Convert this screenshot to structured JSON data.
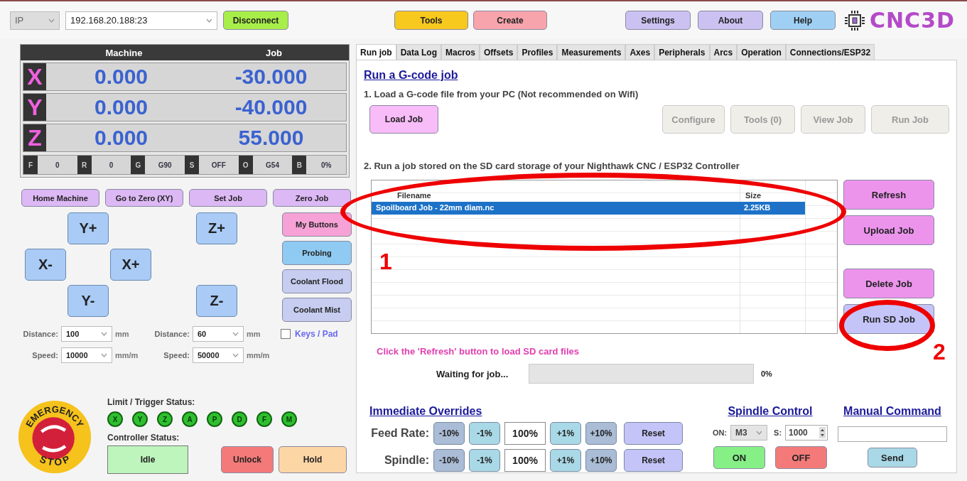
{
  "toolbar": {
    "connection_type": "IP",
    "address": "192.168.20.188:23",
    "left_buttons": [
      {
        "label": "Disconnect",
        "color": "#a8ee4a"
      }
    ],
    "center_buttons": [
      {
        "label": "Tools",
        "color": "#f7c81e"
      },
      {
        "label": "Create",
        "color": "#f8a4ac"
      }
    ],
    "right_buttons": [
      {
        "label": "Settings",
        "color": "#cbc2f2"
      },
      {
        "label": "About",
        "color": "#cbc2f2"
      },
      {
        "label": "Help",
        "color": "#9fd0f4"
      }
    ],
    "logo": "CNC3D"
  },
  "dro": {
    "columns": [
      "Machine",
      "Job"
    ],
    "axes": [
      {
        "axis": "X",
        "machine": "0.000",
        "job": "-30.000"
      },
      {
        "axis": "Y",
        "machine": "0.000",
        "job": "-40.000"
      },
      {
        "axis": "Z",
        "machine": "0.000",
        "job": "55.000"
      }
    ],
    "status": [
      {
        "key": "F",
        "value": "0"
      },
      {
        "key": "R",
        "value": "0"
      },
      {
        "key": "G",
        "value": "G90"
      },
      {
        "key": "S",
        "value": "OFF"
      },
      {
        "key": "O",
        "value": "G54"
      },
      {
        "key": "B",
        "value": "0%"
      }
    ]
  },
  "quick_buttons": [
    {
      "label": "Home Machine",
      "color": "#dcb8f4"
    },
    {
      "label": "Go to Zero (XY)",
      "color": "#dcb8f4"
    },
    {
      "label": "Set Job",
      "color": "#dcb8f4"
    },
    {
      "label": "Zero Job",
      "color": "#dcb8f4"
    }
  ],
  "jog_buttons": [
    {
      "label": "Y+"
    },
    {
      "label": "Z+"
    },
    {
      "label": "X-"
    },
    {
      "label": "X+"
    },
    {
      "label": "Y-"
    },
    {
      "label": "Z-"
    }
  ],
  "side_buttons": [
    {
      "label": "My Buttons",
      "color": "#f6a2d6"
    },
    {
      "label": "Probing",
      "color": "#8ecaf2"
    },
    {
      "label": "Coolant Flood",
      "color": "#c6cdf0"
    },
    {
      "label": "Coolant Mist",
      "color": "#c6cdf0"
    }
  ],
  "jog_settings": [
    {
      "label": "Distance:",
      "value": "100",
      "unit": "mm"
    },
    {
      "label": "Distance:",
      "value": "60",
      "unit": "mm"
    },
    {
      "label": "Speed:",
      "value": "10000",
      "unit": "mm/m"
    },
    {
      "label": "Speed:",
      "value": "50000",
      "unit": "mm/m"
    }
  ],
  "keys_pad": {
    "label": "Keys / Pad",
    "checked": false
  },
  "emergency_stop": {
    "top": "EMERGENCY",
    "bottom": "STOP"
  },
  "limits": {
    "label": "Limit / Trigger Status:",
    "pins": [
      "X",
      "Y",
      "Z",
      "A",
      "P",
      "D",
      "F",
      "M"
    ]
  },
  "controller": {
    "label": "Controller Status:",
    "status": "Idle",
    "buttons": [
      {
        "label": "Unlock",
        "color": "#f47a7a"
      },
      {
        "label": "Hold",
        "color": "#fdd6a6"
      }
    ]
  },
  "tabs": [
    {
      "label": "Run job",
      "selected": true
    },
    {
      "label": "Data Log",
      "selected": false
    },
    {
      "label": "Macros",
      "selected": false
    },
    {
      "label": "Offsets",
      "selected": false
    },
    {
      "label": "Profiles",
      "selected": false
    },
    {
      "label": "Measurements",
      "selected": false
    },
    {
      "label": "Axes",
      "selected": false
    },
    {
      "label": "Peripherals",
      "selected": false
    },
    {
      "label": "Arcs",
      "selected": false
    },
    {
      "label": "Operation",
      "selected": false
    },
    {
      "label": "Connections/ESP32",
      "selected": false
    }
  ],
  "run_job": {
    "title": "Run a G-code job",
    "step1": "1. Load a G-code file from your PC (Not recommended on Wifi)",
    "load_button": {
      "label": "Load Job",
      "color": "#f8bcf8",
      "disabled": false
    },
    "job_buttons": [
      {
        "label": "Configure",
        "color": "#efeee8",
        "disabled": true
      },
      {
        "label": "Tools (0)",
        "color": "#efeee8",
        "disabled": true
      },
      {
        "label": "View Job",
        "color": "#efeee8",
        "disabled": true
      },
      {
        "label": "Run Job",
        "color": "#efeee8",
        "disabled": true
      }
    ],
    "step2": "2. Run a job stored on the SD card storage of your Nighthawk CNC / ESP32 Controller",
    "table": {
      "columns": [
        "Filename",
        "Size"
      ],
      "rows": [
        {
          "filename": "Spoilboard Job - 22mm diam.nc",
          "size": "2.25KB",
          "selected": true
        }
      ]
    },
    "sd_buttons": [
      {
        "label": "Refresh",
        "color": "#ec94ec"
      },
      {
        "label": "Upload Job",
        "color": "#ec94ec"
      },
      {
        "label": "Delete Job",
        "color": "#ec94ec"
      },
      {
        "label": "Run SD Job",
        "color": "#c4c4f8"
      }
    ],
    "hint": "Click the 'Refresh' button to load SD card files",
    "progress": {
      "label": "Waiting for job...",
      "reading": "0%"
    }
  },
  "overrides": {
    "title": "Immediate Overrides",
    "rows": [
      {
        "label": "Feed Rate:",
        "value": "100%",
        "buttons": [
          {
            "label": "-10%",
            "color": "#aabcd6"
          },
          {
            "label": "-1%",
            "color": "#a9d8e6"
          },
          {
            "label": "+1%",
            "color": "#a9d8e6"
          },
          {
            "label": "+10%",
            "color": "#aabcd6"
          },
          {
            "label": "Reset",
            "color": "#c4c4f8"
          }
        ]
      },
      {
        "label": "Spindle:",
        "value": "100%",
        "buttons": [
          {
            "label": "-10%",
            "color": "#aabcd6"
          },
          {
            "label": "-1%",
            "color": "#a9d8e6"
          },
          {
            "label": "+1%",
            "color": "#a9d8e6"
          },
          {
            "label": "+10%",
            "color": "#aabcd6"
          },
          {
            "label": "Reset",
            "color": "#c4c4f8"
          }
        ]
      }
    ]
  },
  "spindle": {
    "title": "Spindle Control",
    "mode_label": "ON:",
    "mode": "M3",
    "speed_label": "S:",
    "speed": "1000",
    "buttons": [
      {
        "label": "ON",
        "color": "#86f086"
      },
      {
        "label": "OFF",
        "color": "#f47a7a"
      }
    ]
  },
  "manual_command": {
    "title": "Manual Command",
    "button": {
      "label": "Send",
      "color": "#a9d8e6"
    }
  },
  "annotations": [
    {
      "label": "1"
    },
    {
      "label": "2"
    }
  ]
}
